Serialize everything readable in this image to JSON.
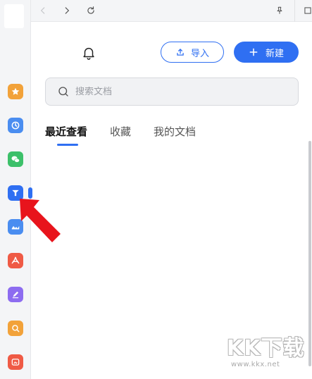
{
  "sidebar": {
    "items": [
      {
        "name": "favorites",
        "icon": "star-icon",
        "color": "#f2a23a"
      },
      {
        "name": "recent",
        "icon": "clock-icon",
        "color": "#4a8df0"
      },
      {
        "name": "wechat",
        "icon": "wechat-icon",
        "color": "#3cc06a"
      },
      {
        "name": "wps-docs",
        "icon": "wps-icon",
        "color": "#2f6ff2"
      },
      {
        "name": "cloud",
        "icon": "cloud-icon",
        "color": "#4a8df0"
      },
      {
        "name": "pdf",
        "icon": "pdf-icon",
        "color": "#ef5a45"
      },
      {
        "name": "form",
        "icon": "pen-icon",
        "color": "#8d6cf0"
      },
      {
        "name": "search",
        "icon": "search-icon",
        "color": "#f2a23a"
      },
      {
        "name": "image",
        "icon": "image-icon",
        "color": "#ef5a45"
      }
    ]
  },
  "toolbar": {
    "back_icon": "chevron-left-icon",
    "forward_icon": "chevron-right-icon",
    "refresh_icon": "refresh-icon",
    "pin_icon": "pin-icon"
  },
  "header": {
    "import_label": "导入",
    "new_label": "新建"
  },
  "search": {
    "placeholder": "搜索文档"
  },
  "tabs": [
    {
      "label": "最近查看",
      "active": true
    },
    {
      "label": "收藏",
      "active": false
    },
    {
      "label": "我的文档",
      "active": false
    }
  ],
  "watermark": {
    "text": "KK下载",
    "url": "www.kkx.net"
  },
  "colors": {
    "accent": "#2f6ff2",
    "arrow": "#e8141c"
  }
}
